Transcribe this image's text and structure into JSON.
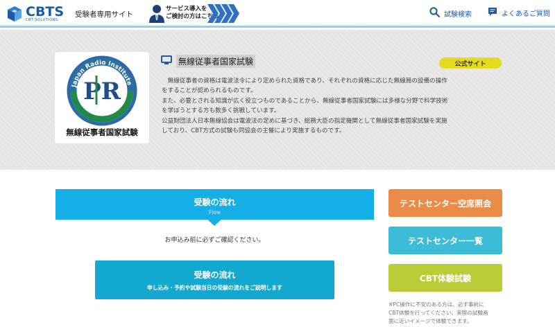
{
  "header": {
    "logo_text": "CBTS",
    "logo_sub": "CBT-SOLUTIONS",
    "site_label": "受験者専用サイト",
    "service_line1": "サービス導入を",
    "service_line2": "ご検討の方はこちら",
    "nav_search": "試験検索",
    "nav_faq": "よくあるご質問",
    "brand_color": "#1b5aa8"
  },
  "hero": {
    "logo_caption": "無線従事者国家試験",
    "logo_ring_text": "Japan Radio Institute",
    "logo_monogram": "PR",
    "exam_title": "無線従事者国家試験",
    "official_badge": "公式サイト",
    "description": [
      "　無線従事者の資格は電波法令により定められた資格であり、それぞれの資格に応じた無線局の設備の操作",
      "をすることが認められるものです。",
      "また、必要とされる知識が広く役立つものであることから、無線従事者国家試験には多様な分野で科学技術",
      "を学ぼうとする方も数多く挑戦しています。",
      "公益財団法人日本無線協会は電波法の定めに基づき、総務大臣の指定機関として無線従事者国家試験を実施",
      "しており、CBT方式の試験も同協会の主催により実施するものです。"
    ]
  },
  "main": {
    "flow_title": "受験の流れ",
    "flow_sub": "Flow",
    "confirm_text": "お申込み前に必ずご確認ください。",
    "flow_button_title": "受験の流れ",
    "flow_button_sub": "申し込み・予約や試験当日の受験の流れをご説明します"
  },
  "side": {
    "availability_label": "テストセンター空席照会",
    "centers_label": "テストセンター一覧",
    "cbt_label": "CBT体験試験",
    "note_lines": [
      "※PC操作に不安のある方は、必ず事前に",
      "CBT体験を行ってください。実際の試験画",
      "面に近いイメージで体験できます。"
    ]
  },
  "colors": {
    "flow_blue": "#14afe6",
    "availability_orange": "#ea8b47",
    "centers_cyan": "#3dbcd7",
    "cbt_green": "#bacd36",
    "badge_yellow": "#e6da1e"
  }
}
